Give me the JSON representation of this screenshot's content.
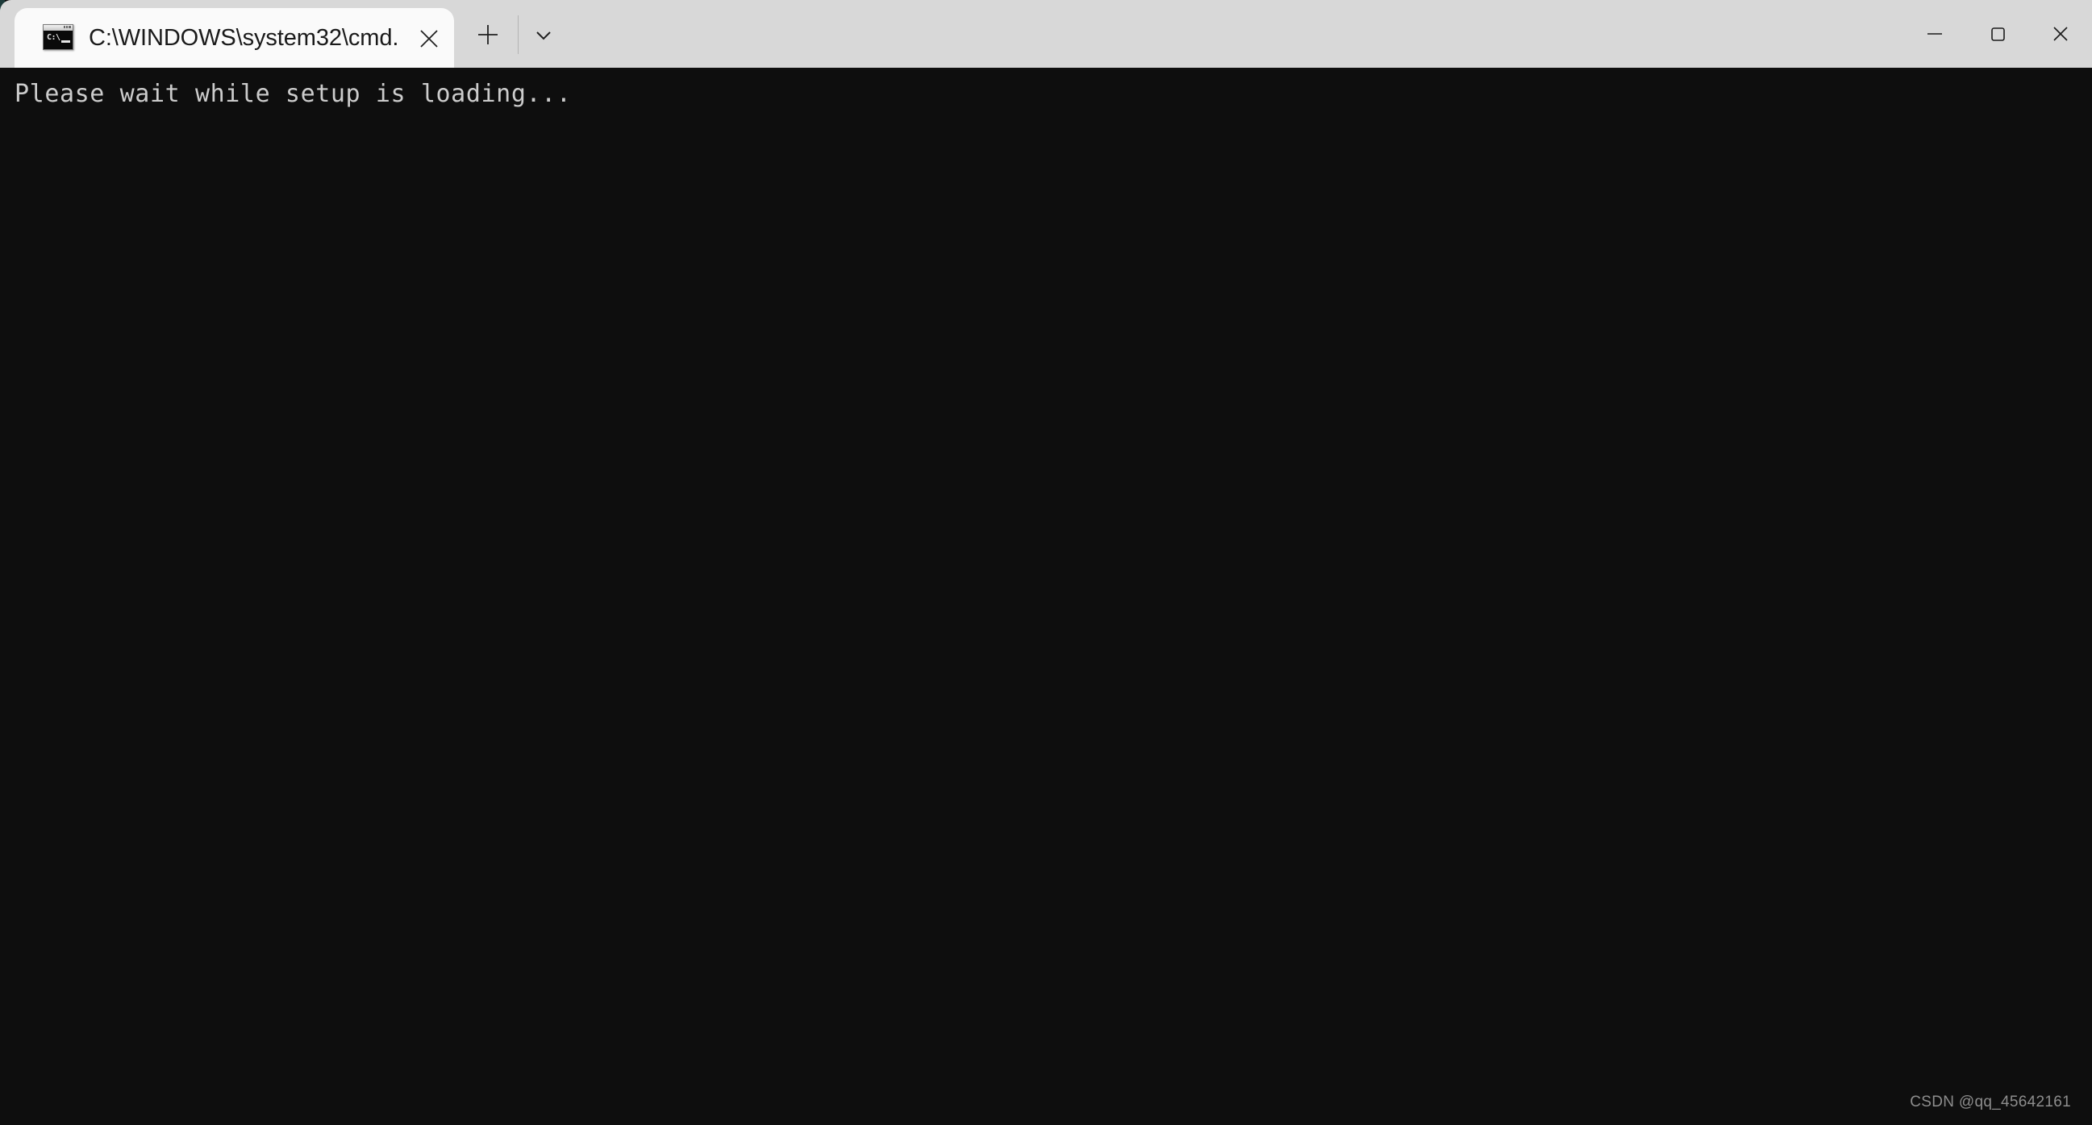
{
  "window": {
    "title_bar": {
      "background_color": "#d8d8d8",
      "tab": {
        "title": "C:\\WINDOWS\\system32\\cmd.",
        "icon_name": "cmd-icon",
        "icon_prompt_text": "C:\\",
        "background_color": "#fafafa",
        "close_label": "×"
      },
      "new_tab_label": "+",
      "dropdown_label": "⌄"
    },
    "controls": {
      "minimize_label": "—",
      "maximize_label": "☐",
      "close_label": "✕"
    }
  },
  "terminal": {
    "background_color": "#0e0e0e",
    "foreground_color": "#cccccc",
    "lines": [
      "Please wait while setup is loading..."
    ],
    "output_text": "Please wait while setup is loading..."
  },
  "watermark": {
    "text": "CSDN @qq_45642161"
  }
}
